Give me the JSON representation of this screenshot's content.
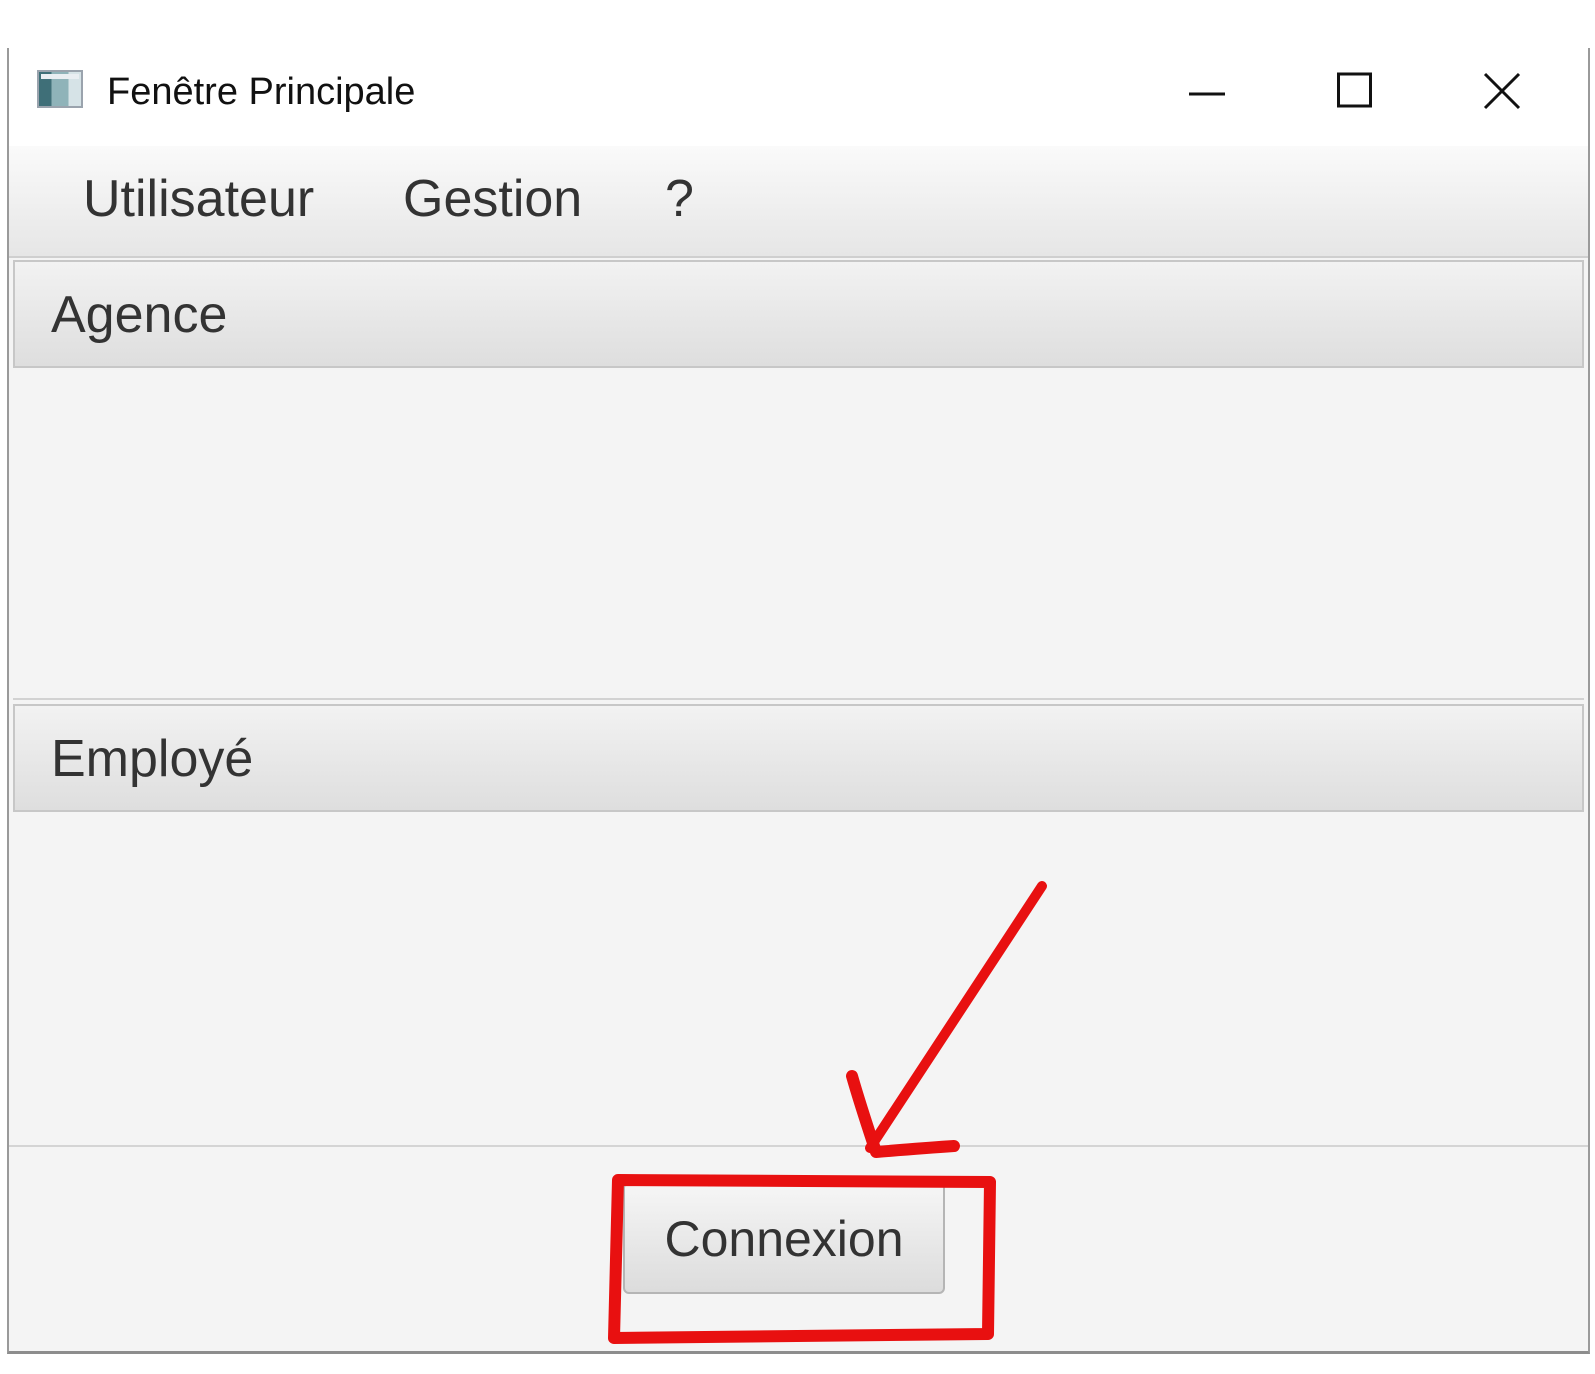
{
  "window": {
    "title": "Fenêtre Principale",
    "controls": [
      "minimize",
      "maximize",
      "close"
    ]
  },
  "menubar": {
    "items": [
      {
        "label": "Utilisateur"
      },
      {
        "label": "Gestion"
      },
      {
        "label": "?"
      }
    ]
  },
  "panes": [
    {
      "title": "Agence"
    },
    {
      "title": "Employé"
    }
  ],
  "footer": {
    "connexion_label": "Connexion"
  },
  "annotation": {
    "color": "#e81010",
    "shapes": [
      "arrow",
      "highlight-box"
    ]
  }
}
